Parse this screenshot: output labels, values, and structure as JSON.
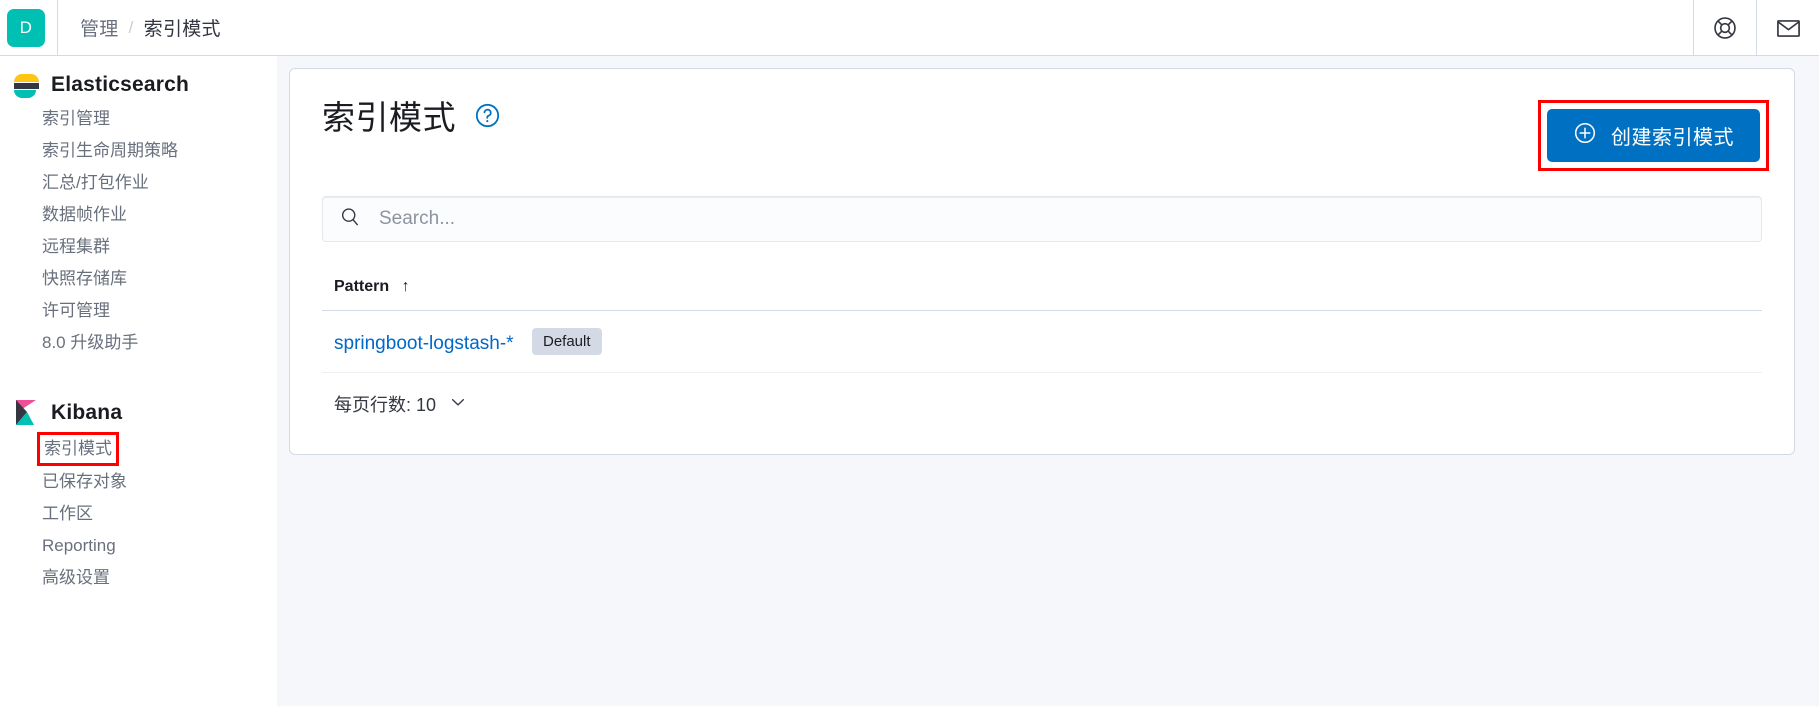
{
  "header": {
    "avatar_letter": "D",
    "breadcrumb": [
      "管理",
      "索引模式"
    ],
    "breadcrumb_separator": "/",
    "icons": [
      {
        "name": "help-lifebuoy-icon"
      },
      {
        "name": "mail-envelope-icon"
      }
    ]
  },
  "sidebar": {
    "groups": [
      {
        "title": "Elasticsearch",
        "logo": "elasticsearch-logo",
        "items": [
          {
            "label": "索引管理",
            "active": false
          },
          {
            "label": "索引生命周期策略",
            "active": false
          },
          {
            "label": "汇总/打包作业",
            "active": false
          },
          {
            "label": "数据帧作业",
            "active": false
          },
          {
            "label": "远程集群",
            "active": false
          },
          {
            "label": "快照存储库",
            "active": false
          },
          {
            "label": "许可管理",
            "active": false
          },
          {
            "label": "8.0 升级助手",
            "active": false
          }
        ]
      },
      {
        "title": "Kibana",
        "logo": "kibana-logo",
        "items": [
          {
            "label": "索引模式",
            "active": true,
            "highlighted": true
          },
          {
            "label": "已保存对象",
            "active": false
          },
          {
            "label": "工作区",
            "active": false
          },
          {
            "label": "Reporting",
            "active": false
          },
          {
            "label": "高级设置",
            "active": false
          }
        ]
      }
    ]
  },
  "main": {
    "page_title": "索引模式",
    "help_icon": "question-mark-circle-icon",
    "create_button": {
      "label": "创建索引模式",
      "icon": "plus-in-circle-icon",
      "color": "#0071c2",
      "highlighted": true
    },
    "search": {
      "placeholder": "Search...",
      "value": "",
      "icon": "search-icon"
    },
    "table": {
      "columns": [
        {
          "label": "Pattern",
          "sort": "asc",
          "sort_icon": "arrow-up-icon"
        }
      ],
      "rows": [
        {
          "pattern": "springboot-logstash-*",
          "badge": "Default"
        }
      ]
    },
    "pagination": {
      "rows_per_page_label": "每页行数: 10",
      "chevron_icon": "chevron-down-icon"
    }
  },
  "colors": {
    "accent_blue": "#0071c2",
    "link_blue": "#0068c9",
    "avatar_teal": "#00bfb3",
    "highlight_red": "#ff0000",
    "page_bg": "#f5f7fa",
    "border": "#d3dae6"
  }
}
